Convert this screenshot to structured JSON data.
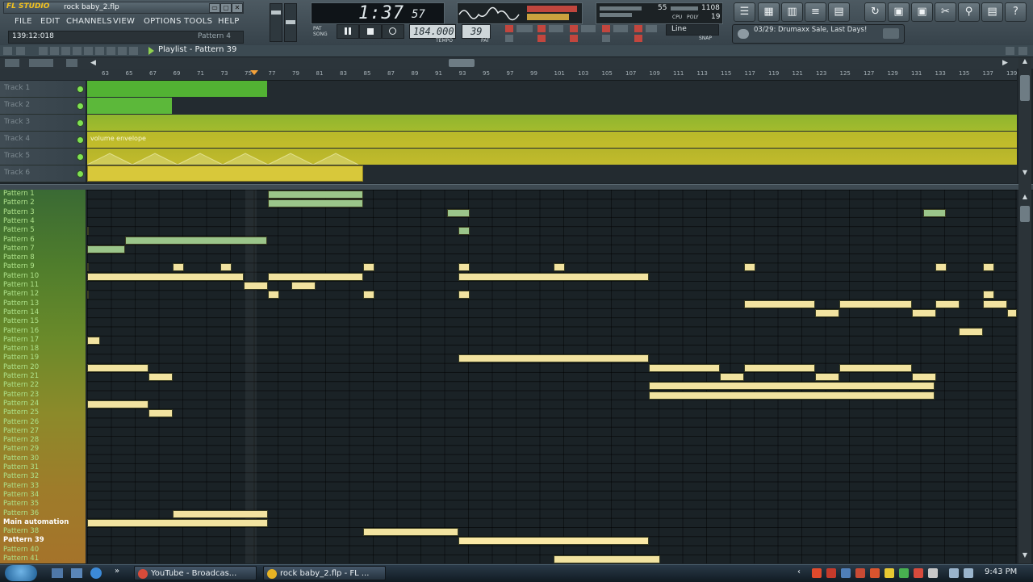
{
  "app": {
    "logo": "FL STUDIO",
    "filename": "rock baby_2.flp",
    "menu": [
      "FILE",
      "EDIT",
      "CHANNELS",
      "VIEW",
      "OPTIONS",
      "TOOLS",
      "HELP"
    ],
    "time_display": "139:12:018",
    "current_pattern": "Pattern 4",
    "song_position_main": "1:37",
    "song_position_sub": "57",
    "tempo": "184.000",
    "tempo_label": "TEMPO",
    "pattern_number": "39",
    "pattern_label": "PAT",
    "snap": "Line",
    "snap_label": "SNAP",
    "cpu_value": "55",
    "mem_value": "1108",
    "poly_value": "19",
    "cpu_label": "CPU",
    "poly_label": "POLY",
    "news": "03/29: Drumaxx Sale, Last Days!"
  },
  "playlist": {
    "title": "Playlist - Pattern 39",
    "ruler_ticks": [
      "63",
      "65",
      "67",
      "69",
      "71",
      "73",
      "75",
      "77",
      "79",
      "81",
      "83",
      "85",
      "87",
      "89",
      "91",
      "93",
      "95",
      "97",
      "99",
      "101",
      "103",
      "105",
      "107",
      "109",
      "111",
      "113",
      "115",
      "117",
      "119",
      "121",
      "123",
      "125",
      "127",
      "129",
      "131",
      "133",
      "135",
      "137",
      "139"
    ],
    "tracks": [
      "Track 1",
      "Track 2",
      "Track 3",
      "Track 4",
      "Track 5",
      "Track 6"
    ],
    "track4_clip_label": "volume envelope",
    "patterns": [
      "Pattern 1",
      "Pattern 2",
      "Pattern 3",
      "Pattern 4",
      "Pattern 5",
      "Pattern 6",
      "Pattern 7",
      "Pattern 8",
      "Pattern 9",
      "Pattern 10",
      "Pattern 11",
      "Pattern 12",
      "Pattern 13",
      "Pattern 14",
      "Pattern 15",
      "Pattern 16",
      "Pattern 17",
      "Pattern 18",
      "Pattern 19",
      "Pattern 20",
      "Pattern 21",
      "Pattern 22",
      "Pattern 23",
      "Pattern 24",
      "Pattern 25",
      "Pattern 26",
      "Pattern 27",
      "Pattern 28",
      "Pattern 29",
      "Pattern 30",
      "Pattern 31",
      "Pattern 32",
      "Pattern 33",
      "Pattern 34",
      "Pattern 35",
      "Pattern 36",
      "Main automation",
      "Pattern 38",
      "Pattern 39",
      "Pattern 40",
      "Pattern 41"
    ],
    "selected_pattern": "Pattern 39"
  },
  "taskbar": {
    "tasks": [
      "YouTube - Broadcas...",
      "rock baby_2.flp - FL ..."
    ],
    "clock": "9:43 PM"
  },
  "colors": {
    "track_green": "#58b838",
    "track_olive": "#a9b82a",
    "pattern_green": "#9bc58a",
    "pattern_yellow": "#f2e3a0",
    "pattern_bright": "#fbe9a6"
  }
}
